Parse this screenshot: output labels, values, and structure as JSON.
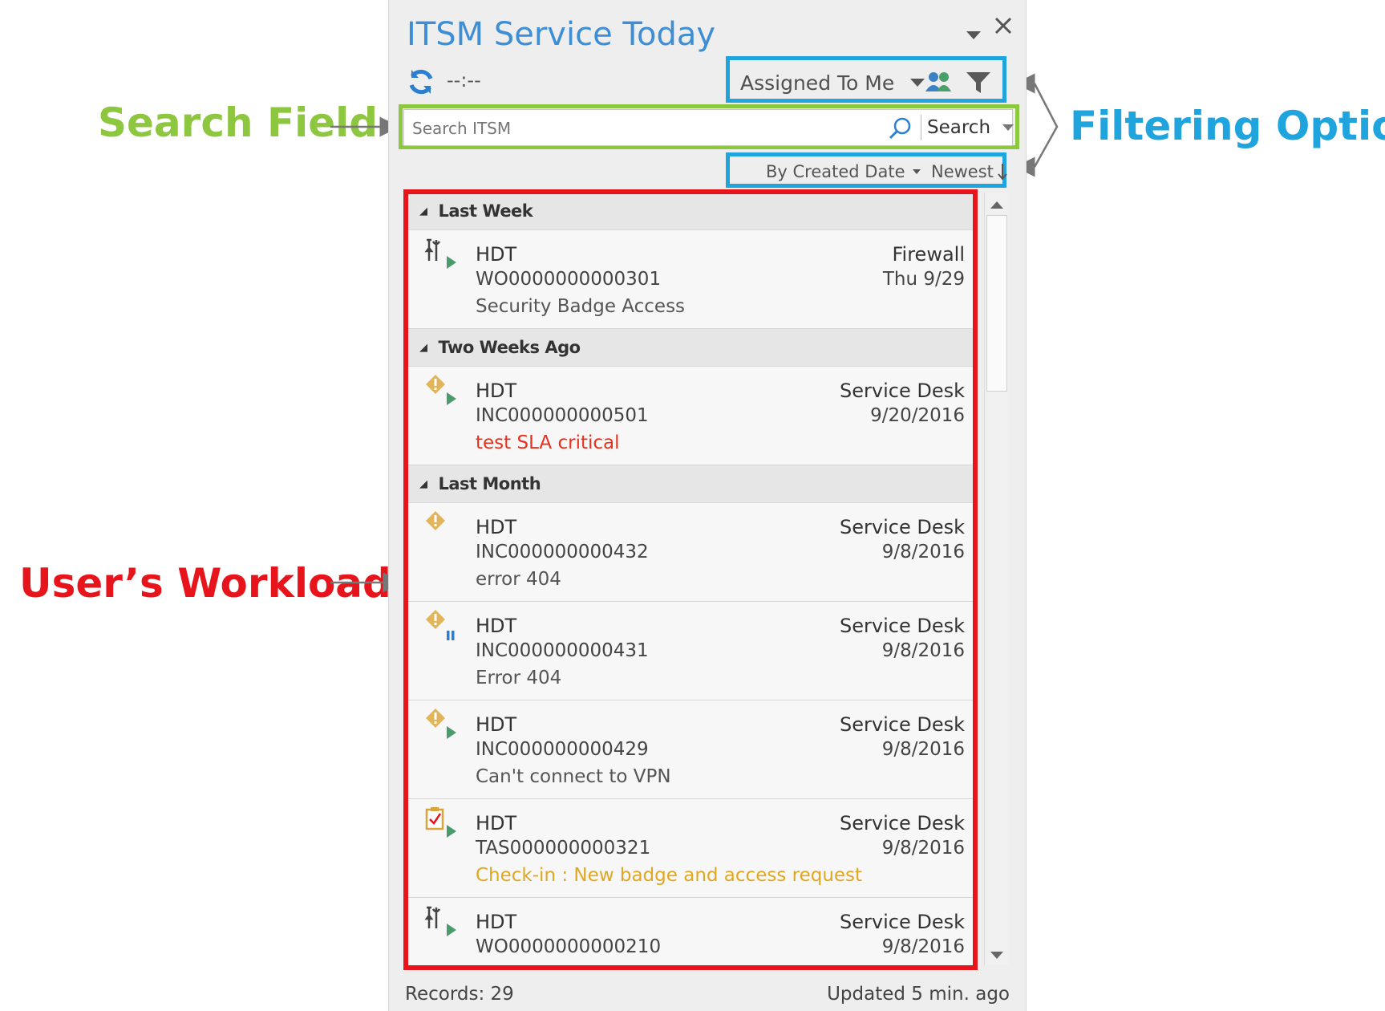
{
  "annotations": {
    "search_field": "Search Field",
    "filtering_options": "Filtering Options",
    "users_workload": "User’s Workload",
    "colors": {
      "green": "#8dc63f",
      "blue": "#1fa4de",
      "red": "#e8141c"
    }
  },
  "panel": {
    "title": "ITSM Service Today",
    "last_sync": "--:--",
    "assigned_filter": "Assigned To Me",
    "search_placeholder": "Search ITSM",
    "search_button": "Search",
    "sort_by": "By Created Date",
    "sort_order": "Newest"
  },
  "groups": [
    {
      "label": "Last Week",
      "items": [
        {
          "icon": "work-order-icon",
          "badge": "play",
          "line1": "HDT",
          "line2": "WO0000000000301",
          "line3": "Security Badge Access",
          "line3_color": "#555555",
          "right1": "Firewall",
          "right2": "Thu 9/29"
        }
      ]
    },
    {
      "label": "Two Weeks Ago",
      "items": [
        {
          "icon": "incident-icon",
          "badge": "play",
          "line1": "HDT",
          "line2": "INC000000000501",
          "line3": "test SLA critical",
          "line3_color": "#e8301c",
          "right1": "Service Desk",
          "right2": "9/20/2016"
        }
      ]
    },
    {
      "label": "Last Month",
      "items": [
        {
          "icon": "incident-icon",
          "badge": "none",
          "line1": "HDT",
          "line2": "INC000000000432",
          "line3": "error 404",
          "line3_color": "#555555",
          "right1": "Service Desk",
          "right2": "9/8/2016"
        },
        {
          "icon": "incident-icon",
          "badge": "pause",
          "line1": "HDT",
          "line2": "INC000000000431",
          "line3": "Error 404",
          "line3_color": "#555555",
          "right1": "Service Desk",
          "right2": "9/8/2016"
        },
        {
          "icon": "incident-icon",
          "badge": "play",
          "line1": "HDT",
          "line2": "INC000000000429",
          "line3": "Can't connect to VPN",
          "line3_color": "#555555",
          "right1": "Service Desk",
          "right2": "9/8/2016"
        },
        {
          "icon": "task-icon",
          "badge": "play",
          "line1": "HDT",
          "line2": "TAS000000000321",
          "line3": "Check-in : New badge and access request",
          "line3_color": "#e0a820",
          "right1": "Service Desk",
          "right2": "9/8/2016"
        },
        {
          "icon": "work-order-icon",
          "badge": "play",
          "line1": "HDT",
          "line2": "WO0000000000210",
          "line3": "",
          "line3_color": "#555555",
          "right1": "Service Desk",
          "right2": "9/8/2016"
        }
      ]
    }
  ],
  "status": {
    "records": "Records: 29",
    "updated": "Updated 5 min. ago"
  }
}
